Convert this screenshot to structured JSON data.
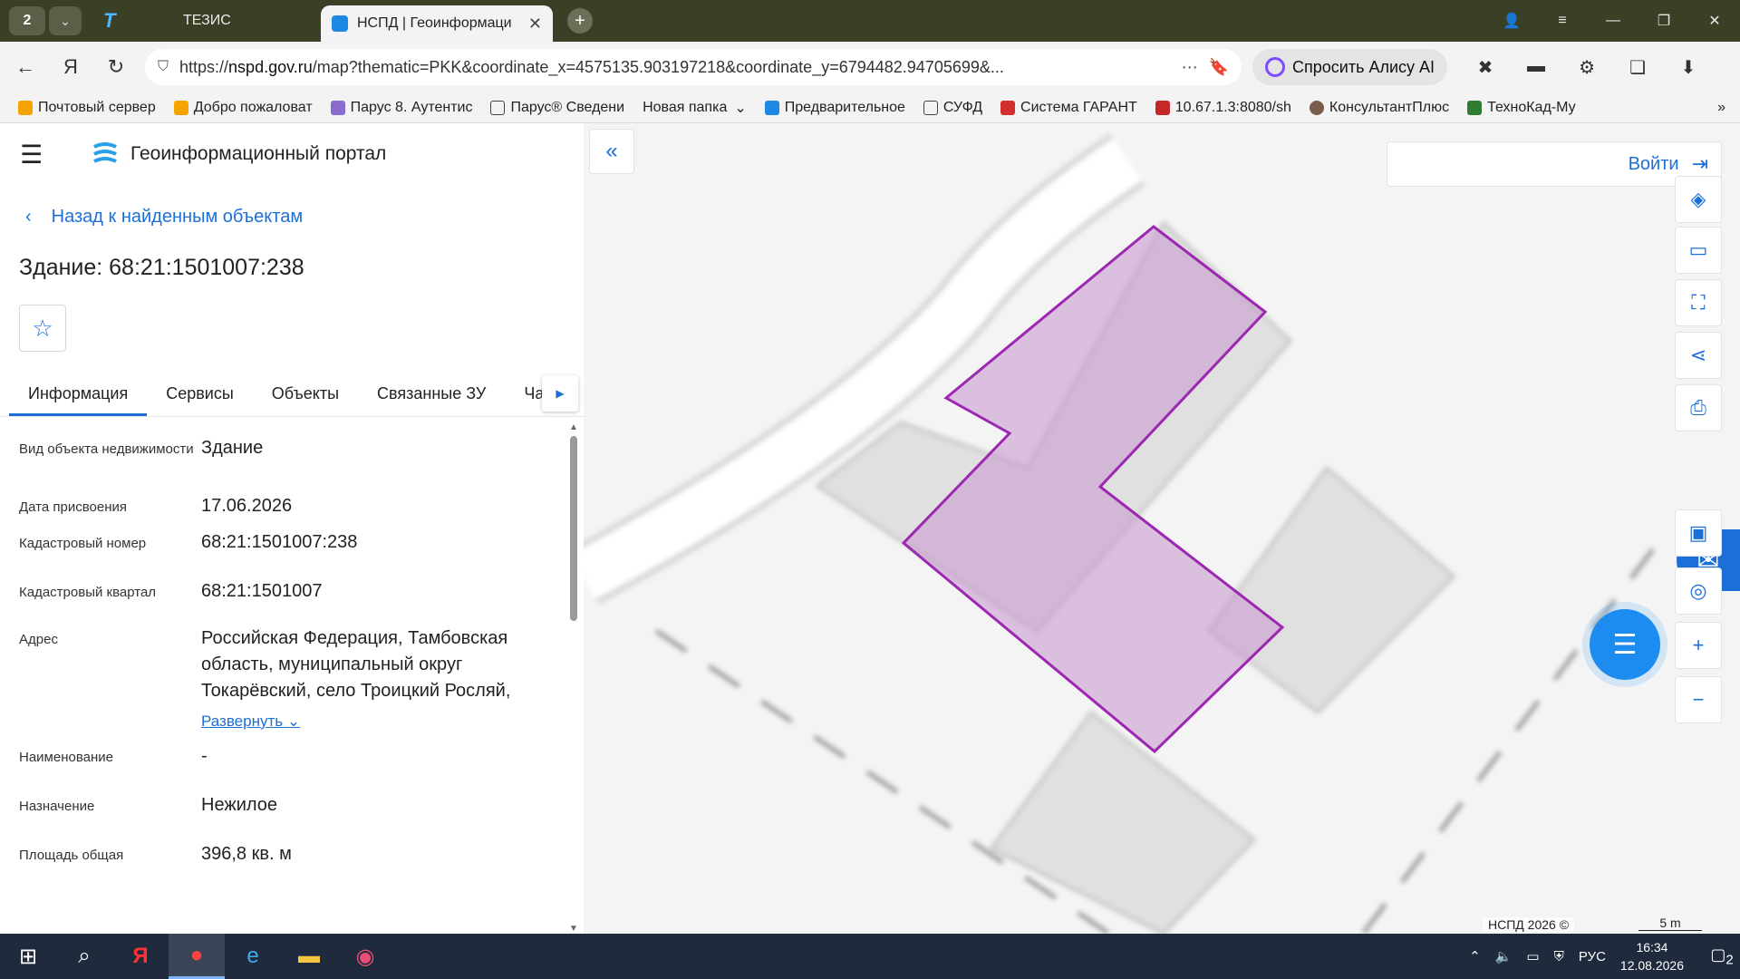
{
  "browser": {
    "tab_group_count": "2",
    "tabs": [
      {
        "label": "ТЕЗИС"
      },
      {
        "label": "НСПД | Геоинформаци"
      }
    ],
    "url_host": "nspd.gov.ru",
    "url_prefix": "https://",
    "url_rest": "/map?thematic=PKK&coordinate_x=4575135.903197218&coordinate_y=6794482.94705699&...",
    "alice_label": "Спросить Алису AI",
    "bookmarks": [
      {
        "label": "Почтовый сервер"
      },
      {
        "label": "Добро пожаловат"
      },
      {
        "label": "Парус 8. Аутентис"
      },
      {
        "label": "Парус® Сведени"
      },
      {
        "label": "Новая папка"
      },
      {
        "label": "Предварительное"
      },
      {
        "label": "СУФД"
      },
      {
        "label": "Система ГАРАНТ"
      },
      {
        "label": "10.67.1.3:8080/sh"
      },
      {
        "label": "КонсультантПлюс"
      },
      {
        "label": "ТехноКад-Му"
      }
    ]
  },
  "portal": {
    "title": "Геоинформационный портал",
    "back_label": "Назад к найденным объектам",
    "object_title": "Здание: 68:21:1501007:238",
    "tabs": [
      {
        "label": "Информация"
      },
      {
        "label": "Сервисы"
      },
      {
        "label": "Объекты"
      },
      {
        "label": "Связанные ЗУ"
      },
      {
        "label": "Ча"
      }
    ],
    "properties": [
      {
        "label": "Вид объекта недвижимости",
        "value": "Здание"
      },
      {
        "label": "Дата присвоения",
        "value": "17.06.2026"
      },
      {
        "label": "Кадастровый номер",
        "value": "68:21:1501007:238"
      },
      {
        "label": "Кадастровый квартал",
        "value": "68:21:1501007"
      },
      {
        "label": "Адрес",
        "value": "Российская Федерация, Тамбовская область, муниципальный округ Токарёвский, село Троицкий Росляй,"
      },
      {
        "label": "Наименование",
        "value": "-"
      },
      {
        "label": "Назначение",
        "value": "Нежилое"
      },
      {
        "label": "Площадь общая",
        "value": "396,8 кв. м"
      }
    ],
    "expand_label": "Развернуть"
  },
  "map": {
    "login_label": "Войти",
    "copyright": "НСПД 2026 ©",
    "scale": "5 m",
    "highlight_color": "#9c27b0"
  },
  "taskbar": {
    "lang": "РУС",
    "time": "16:34",
    "date": "12.08.2026",
    "notifications": "2"
  }
}
